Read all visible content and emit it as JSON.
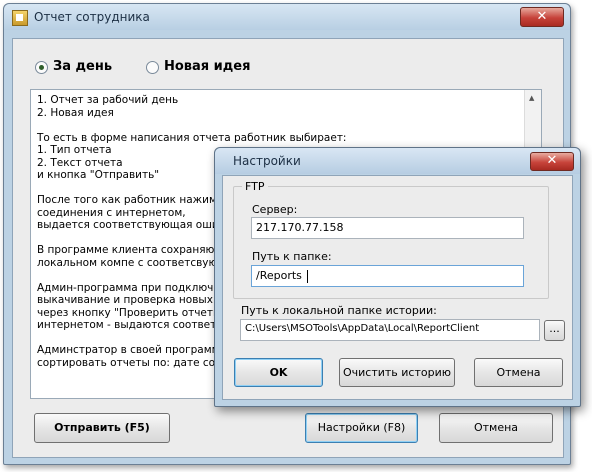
{
  "main_window": {
    "title": "Отчет сотрудника",
    "close_glyph": "✕",
    "radios": [
      {
        "label": "За день",
        "selected": true
      },
      {
        "label": "Новая идея",
        "selected": false
      }
    ],
    "memo_text": "1. Отчет за рабочий день\n2. Новая идея\n\nТо есть в форме написания отчета работник выбирает:\n1. Тип отчета\n2. Текст отчета\nи кнопка \"Отправить\"\n\nПосле того как работник нажимае\nсоединения с интернетом,\nвыдается соответствующая ошибк\n\nВ программе клиента сохраняютс\nлокальном компе с соответсвующ\n\nАдмин-программа при подключени\nвыкачивание и проверка новых от\nчерез кнопку \"Проверить отчеты\"\nинтернетом - выдаются соответст\n\nАдминстратор в своей программе\nсортировать отчеты по: дате созда",
    "buttons": {
      "send": "Отправить (F5)",
      "settings": "Настройки (F8)",
      "cancel": "Отмена"
    }
  },
  "settings_dialog": {
    "title": "Настройки",
    "close_glyph": "✕",
    "ftp_group_title": "FTP",
    "server_label": "Сервер:",
    "server_value": "217.170.77.158",
    "folder_label": "Путь к папке:",
    "folder_value": "/Reports",
    "history_label": "Путь к локальной папке истории:",
    "history_value": "C:\\Users\\MSOTools\\AppData\\Local\\ReportClient",
    "browse_label": "...",
    "buttons": {
      "ok": "OK",
      "clear_history": "Очистить историю",
      "cancel": "Отмена"
    }
  }
}
